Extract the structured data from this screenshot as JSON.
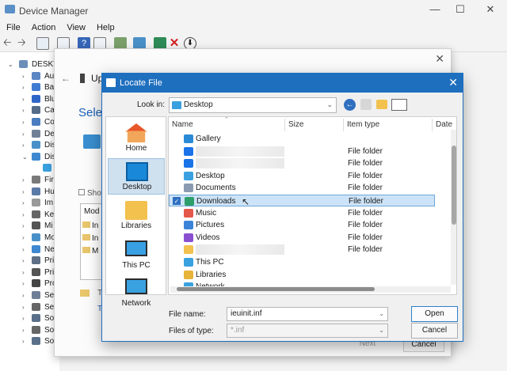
{
  "device_manager": {
    "title": "Device Manager",
    "menu": [
      "File",
      "Action",
      "View",
      "Help"
    ],
    "tree": [
      {
        "label": "DESKT",
        "expanded": true
      },
      {
        "label": "Au"
      },
      {
        "label": "Ba"
      },
      {
        "label": "Blu"
      },
      {
        "label": "Ca"
      },
      {
        "label": "Co"
      },
      {
        "label": "De"
      },
      {
        "label": "Dis"
      },
      {
        "label": "Dis",
        "expanded": true
      },
      {
        "label": "",
        "child": true
      },
      {
        "label": "Fir"
      },
      {
        "label": "Hu"
      },
      {
        "label": "Im"
      },
      {
        "label": "Ke"
      },
      {
        "label": "Mi"
      },
      {
        "label": "Mo"
      },
      {
        "label": "Ne"
      },
      {
        "label": "Pri"
      },
      {
        "label": "Pri"
      },
      {
        "label": "Pro"
      },
      {
        "label": "Se"
      },
      {
        "label": "Se"
      },
      {
        "label": "So"
      },
      {
        "label": "So"
      },
      {
        "label": "So"
      }
    ]
  },
  "wizard": {
    "title_partial": "Up",
    "heading_partial": "Selec",
    "show_label": "Show",
    "model_header": "Mod",
    "model_items": [
      "In",
      "In",
      "M"
    ],
    "letters": [
      "T",
      "T"
    ],
    "next_label": "Next",
    "cancel_label": "Cancel"
  },
  "locate_file": {
    "title": "Locate File",
    "look_in_label": "Look in:",
    "look_in_value": "Desktop",
    "places": [
      "Home",
      "Desktop",
      "Libraries",
      "This PC",
      "Network"
    ],
    "selected_place": "Desktop",
    "columns": [
      "Name",
      "Size",
      "Item type",
      "Date"
    ],
    "files": [
      {
        "name": "Gallery",
        "type": "",
        "icon": "gallery-icon",
        "color": "#2b8ad6"
      },
      {
        "name": "",
        "type": "File folder",
        "icon": "onedrive-icon",
        "color": "#1a73e8",
        "blurred": true
      },
      {
        "name": "",
        "type": "File folder",
        "icon": "onedrive-icon",
        "color": "#1a73e8",
        "blurred": true
      },
      {
        "name": "Desktop",
        "type": "File folder",
        "icon": "desktop-folder-icon",
        "color": "#3aa1e0"
      },
      {
        "name": "Documents",
        "type": "File folder",
        "icon": "documents-folder-icon",
        "color": "#8a9bb0"
      },
      {
        "name": "Downloads",
        "type": "File folder",
        "icon": "downloads-folder-icon",
        "color": "#2e9e6a",
        "selected": true
      },
      {
        "name": "Music",
        "type": "File folder",
        "icon": "music-folder-icon",
        "color": "#e4574b"
      },
      {
        "name": "Pictures",
        "type": "File folder",
        "icon": "pictures-folder-icon",
        "color": "#3b83d8"
      },
      {
        "name": "Videos",
        "type": "File folder",
        "icon": "videos-folder-icon",
        "color": "#8a4fd1"
      },
      {
        "name": "",
        "type": "File folder",
        "icon": "folder-icon",
        "color": "#f2c14e",
        "blurred": true
      },
      {
        "name": "This PC",
        "type": "",
        "icon": "this-pc-icon",
        "color": "#3aa1e0"
      },
      {
        "name": "Libraries",
        "type": "",
        "icon": "libraries-icon",
        "color": "#e7b33a"
      },
      {
        "name": "Network",
        "type": "",
        "icon": "network-icon",
        "color": "#3aa1e0"
      }
    ],
    "file_name_label": "File name:",
    "file_name_value": "ieuinit.inf",
    "files_of_type_label": "Files of type:",
    "files_of_type_value": "*.inf",
    "open_label": "Open",
    "cancel_label": "Cancel"
  }
}
